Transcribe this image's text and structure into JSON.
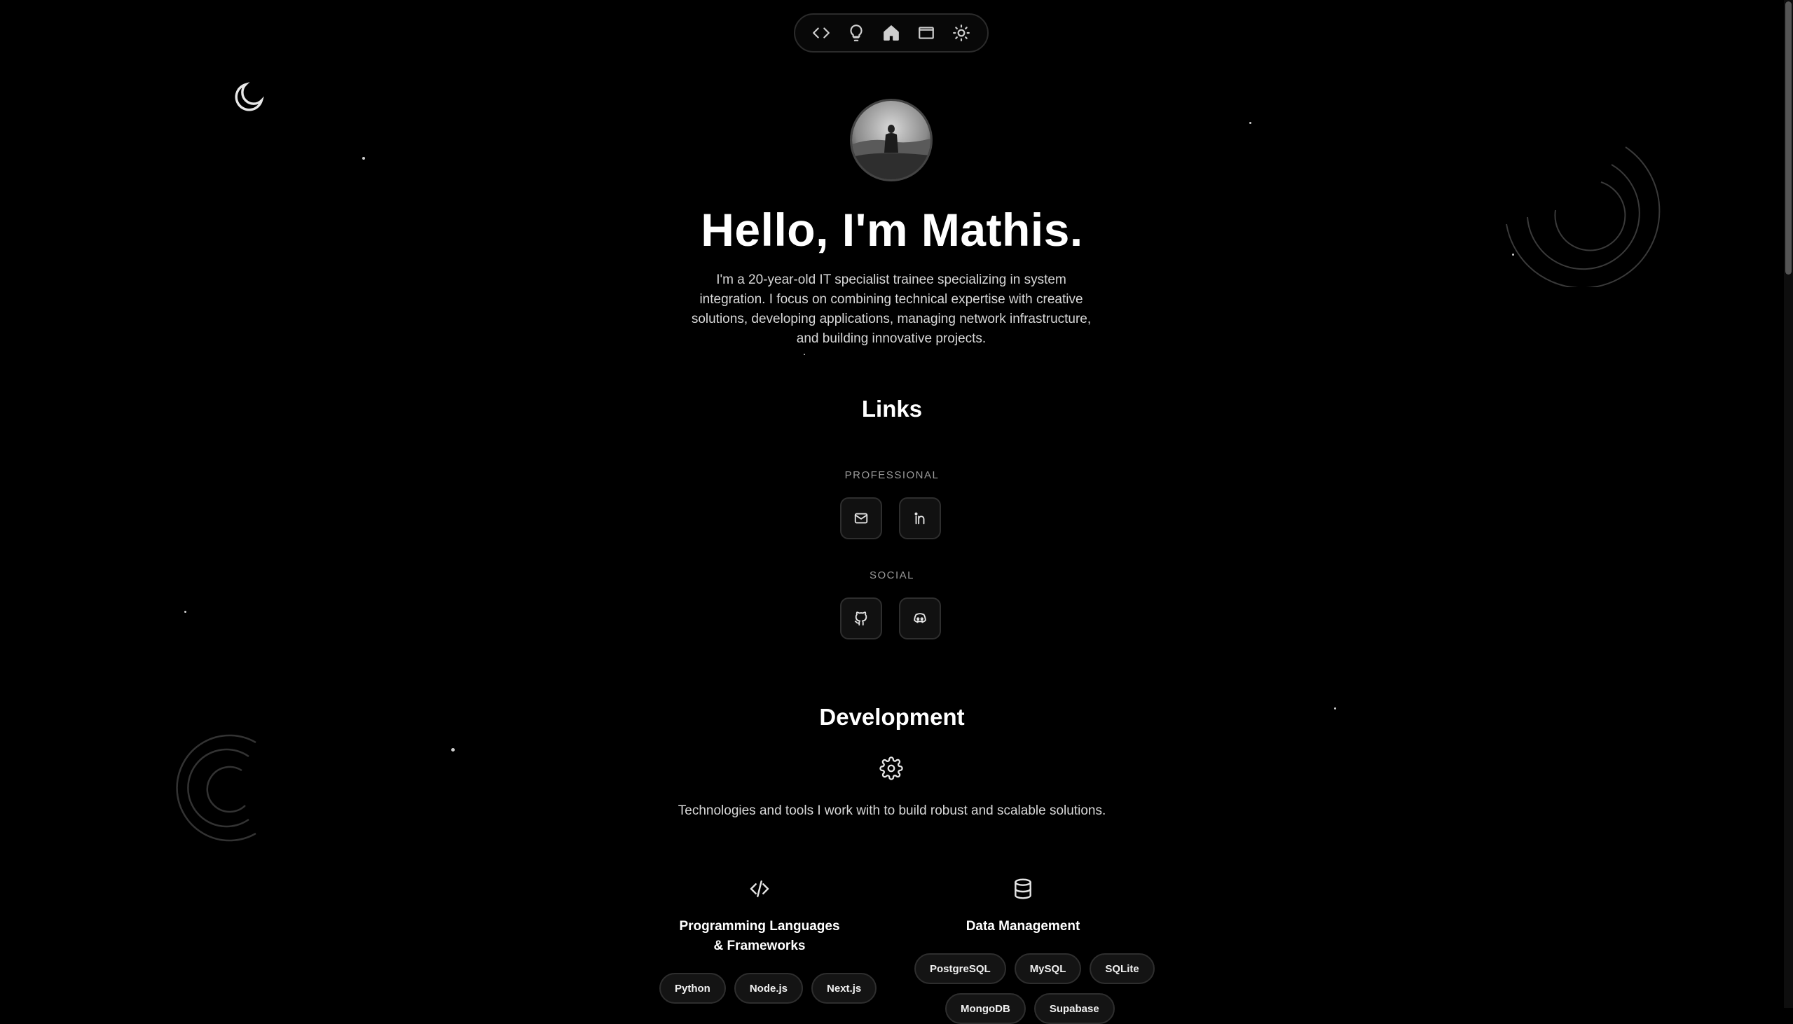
{
  "nav": {
    "items": [
      {
        "icon": "code-icon"
      },
      {
        "icon": "lightbulb-icon"
      },
      {
        "icon": "home-icon"
      },
      {
        "icon": "mail-icon"
      },
      {
        "icon": "sun-icon"
      }
    ]
  },
  "hero": {
    "title": "Hello, I'm Mathis.",
    "text": "I'm a 20-year-old IT specialist trainee specializing in system integration. I focus on combining technical expertise with creative solutions, developing applications, managing network infrastructure, and building innovative projects."
  },
  "links": {
    "title": "Links",
    "professional_label": "PROFESSIONAL",
    "social_label": "SOCIAL",
    "professional": [
      {
        "icon": "mail-icon"
      },
      {
        "icon": "linkedin-icon"
      }
    ],
    "social": [
      {
        "icon": "github-icon"
      },
      {
        "icon": "discord-icon"
      }
    ]
  },
  "development": {
    "title": "Development",
    "subtitle": "Technologies and tools I work with to build robust and scalable solutions.",
    "columns": [
      {
        "title": "Programming Languages & Frameworks",
        "icon": "code-icon",
        "tags": [
          "Python",
          "Node.js",
          "Next.js"
        ]
      },
      {
        "title": "Data Management",
        "icon": "database-icon",
        "tags": [
          "PostgreSQL",
          "MySQL",
          "SQLite",
          "MongoDB",
          "Supabase"
        ]
      }
    ]
  }
}
